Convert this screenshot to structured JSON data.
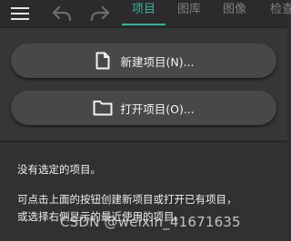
{
  "toolbar": {
    "menu_icon": "hamburger-menu-icon",
    "back_icon": "undo-arrow-icon",
    "forward_icon": "redo-arrow-icon"
  },
  "tabs": [
    {
      "label": "项目",
      "active": true
    },
    {
      "label": "图库",
      "active": false
    },
    {
      "label": "图像",
      "active": false
    },
    {
      "label": "检查",
      "active": false
    }
  ],
  "colors": {
    "accent": "#39b3a1",
    "background": "#303030",
    "button": "#484848",
    "text": "#f0f0f0",
    "inactive_tab": "#7e7e7e"
  },
  "actions": {
    "new_project": {
      "label": "新建项目(N)...",
      "icon": "new-document-icon"
    },
    "open_project": {
      "label": "打开项目(O)...",
      "icon": "folder-icon"
    }
  },
  "message": {
    "title": "没有选定的项目。",
    "body_line1": "可点击上面的按钮创建新项目或打开已有项目，",
    "body_line2": "或选择右侧显示的最近使用的项目。"
  },
  "watermark": "CSDN @weixin_41671635"
}
